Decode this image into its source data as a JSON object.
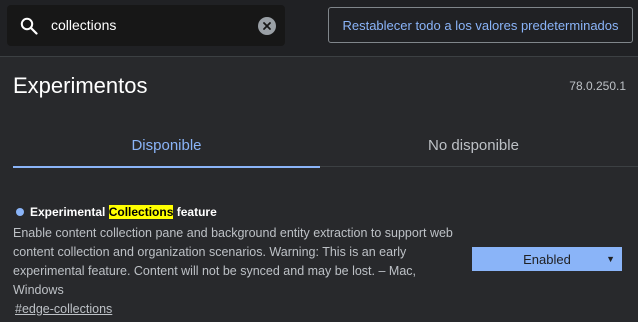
{
  "search": {
    "value": "collections",
    "placeholder": ""
  },
  "reset_button_label": "Restablecer todo a los valores predeterminados",
  "title": "Experimentos",
  "version": "78.0.250.1",
  "tabs": [
    {
      "label": "Disponible",
      "selected": true
    },
    {
      "label": "No disponible",
      "selected": false
    }
  ],
  "experiment": {
    "title_before": "Experimental ",
    "title_highlight": "Collections",
    "title_after": " feature",
    "description": "Enable content collection pane and background entity extraction to support web content collection and organization scenarios. Warning: This is an early experimental feature. Content will not be synced and may be lost. – Mac, Windows",
    "link": "#edge-collections",
    "select_value": "Enabled"
  },
  "colors": {
    "accent": "#8ab4f8",
    "highlight": "#ffff00",
    "background": "#28292c",
    "topbar": "#202124"
  },
  "icons": {
    "search": "search-icon",
    "clear": "clear-icon",
    "dropdown": "dropdown-arrow-icon",
    "status_dot": "status-dot-icon"
  }
}
